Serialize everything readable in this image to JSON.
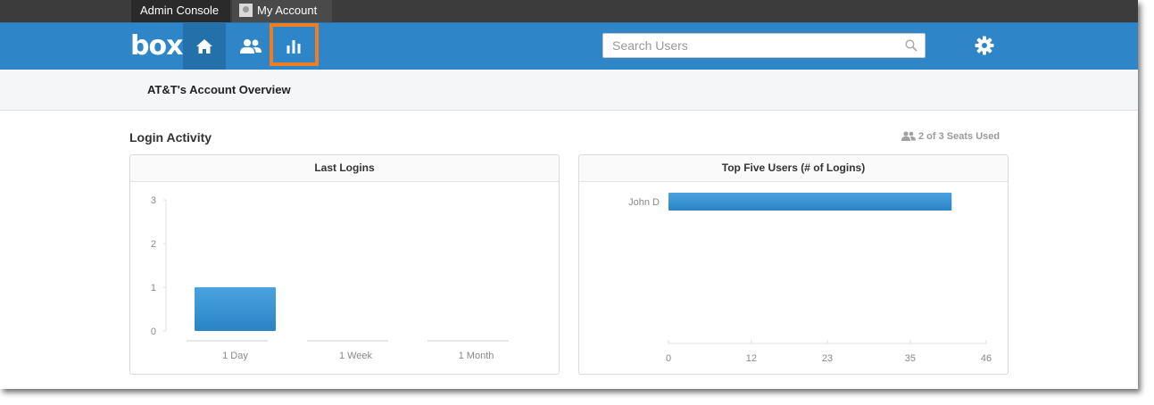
{
  "topbar": {
    "admin_console_label": "Admin Console",
    "my_account_label": "My Account"
  },
  "navbar": {
    "logo_text": "box",
    "home_icon": "home-icon",
    "users_icon": "users-icon",
    "reports_icon": "bar-chart-icon",
    "settings_icon": "gear-icon",
    "active_item": "reports",
    "highlight_color": "#f07d1f",
    "nav_color": "#2e86c8"
  },
  "search": {
    "placeholder": "Search Users",
    "value": ""
  },
  "subheader": {
    "title": "AT&T's Account Overview"
  },
  "section": {
    "title": "Login Activity",
    "seats_text": "2 of 3 Seats Used"
  },
  "panels": {
    "last_logins_title": "Last Logins",
    "top_users_title": "Top Five Users (# of Logins)"
  },
  "chart_data": [
    {
      "type": "bar",
      "title": "Last Logins",
      "categories": [
        "1 Day",
        "1 Week",
        "1 Month"
      ],
      "values": [
        1,
        0,
        0
      ],
      "ylim": [
        0,
        3
      ],
      "yticks": [
        0,
        1,
        2,
        3
      ],
      "orientation": "vertical",
      "color": "#3a94d6"
    },
    {
      "type": "bar",
      "title": "Top Five Users (# of Logins)",
      "categories": [
        "John D"
      ],
      "values": [
        41
      ],
      "xlim": [
        0,
        46
      ],
      "xticks": [
        0,
        12,
        23,
        35,
        46
      ],
      "orientation": "horizontal",
      "color": "#3a94d6"
    }
  ]
}
